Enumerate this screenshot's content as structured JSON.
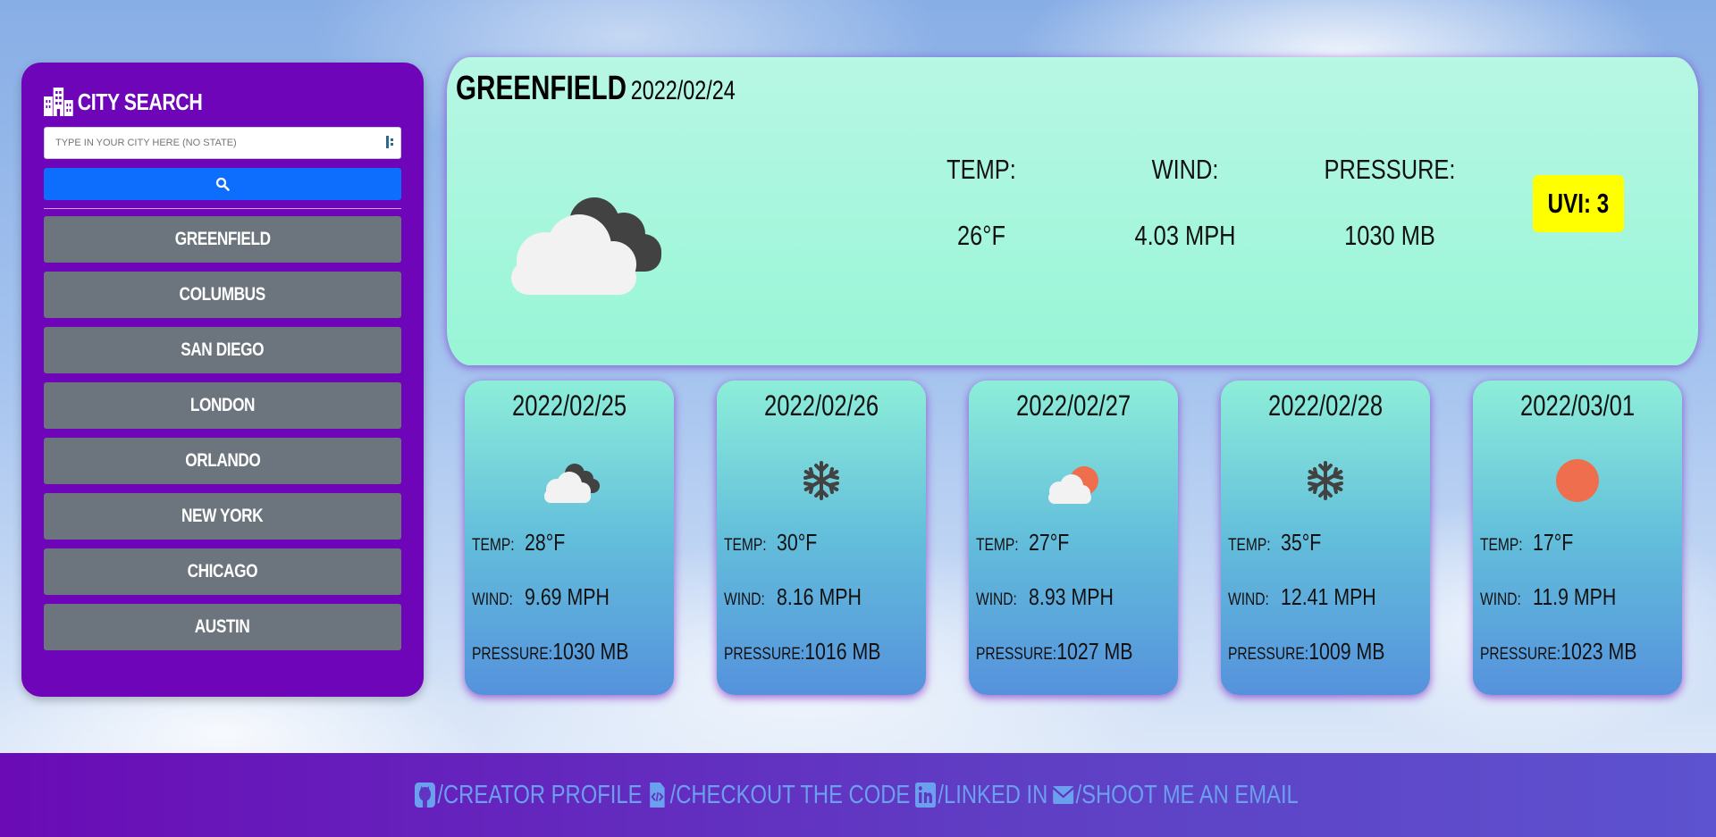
{
  "sidebar": {
    "title": "City Search",
    "title_icon": "city-icon",
    "search_placeholder": "TYPE IN YOUR CITY HERE (NO STATE)",
    "search_value": "",
    "search_button_icon": "search-icon",
    "cities": [
      "GREENFIELD",
      "COLUMBUS",
      "SAN DIEGO",
      "LONDON",
      "ORLANDO",
      "NEW YORK",
      "CHICAGO",
      "AUSTIN"
    ]
  },
  "current": {
    "city": "Greenfield",
    "date": "2022/02/24",
    "icon": "cloudy-icon",
    "temp_label": "Temp:",
    "temp": "26°F",
    "wind_label": "Wind:",
    "wind": "4.03 MPH",
    "pressure_label": "Pressure:",
    "pressure": "1030 MB",
    "uvi_text": "UVI: 3",
    "uvi_color": "#ffff00"
  },
  "forecast": [
    {
      "date": "2022/02/25",
      "icon": "cloudy-icon",
      "temp_label": "Temp:",
      "temp": "28°F",
      "wind_label": "Wind:",
      "wind": "9.69 MPH",
      "pressure_label": "Pressure:",
      "pressure": "1030 MB"
    },
    {
      "date": "2022/02/26",
      "icon": "snowflake-icon",
      "temp_label": "Temp:",
      "temp": "30°F",
      "wind_label": "Wind:",
      "wind": "8.16 MPH",
      "pressure_label": "Pressure:",
      "pressure": "1016 MB"
    },
    {
      "date": "2022/02/27",
      "icon": "partly-sunny-icon",
      "temp_label": "Temp:",
      "temp": "27°F",
      "wind_label": "Wind:",
      "wind": "8.93 MPH",
      "pressure_label": "Pressure:",
      "pressure": "1027 MB"
    },
    {
      "date": "2022/02/28",
      "icon": "snowflake-icon",
      "temp_label": "Temp:",
      "temp": "35°F",
      "wind_label": "Wind:",
      "wind": "12.41 MPH",
      "pressure_label": "Pressure:",
      "pressure": "1009 MB"
    },
    {
      "date": "2022/03/01",
      "icon": "sun-icon",
      "temp_label": "Temp:",
      "temp": "17°F",
      "wind_label": "Wind:",
      "wind": "11.9 MPH",
      "pressure_label": "Pressure:",
      "pressure": "1023 MB"
    }
  ],
  "footer": {
    "links": [
      {
        "icon": "github-icon",
        "label": "/Creator Profile"
      },
      {
        "icon": "code-file-icon",
        "label": "/Checkout the code"
      },
      {
        "icon": "linkedin-icon",
        "label": "/Linked In"
      },
      {
        "icon": "envelope-icon",
        "label": "/Shoot me an email"
      }
    ]
  },
  "colors": {
    "sidebar_bg": "#6f05b9",
    "search_button": "#0d6efd",
    "city_button": "#6c757d",
    "current_bg": "#a8f6de",
    "footer_link": "#6aa0ee",
    "sun": "#ee6e4d"
  }
}
